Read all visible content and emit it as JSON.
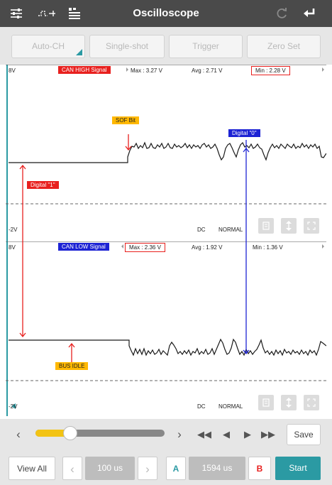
{
  "header": {
    "title": "Oscilloscope",
    "icons": [
      "settings-sliders-icon",
      "waveform-measure-icon",
      "channel-list-icon",
      "refresh-icon",
      "back-arrow-icon"
    ]
  },
  "channel_buttons": [
    "Auto-CH",
    "Single-shot",
    "Trigger",
    "Zero Set"
  ],
  "ch1": {
    "top_voltage": "8V",
    "bottom_voltage": "-2V",
    "signal_name": "CAN HIGH Signal",
    "max": "Max : 3.27 V",
    "avg": "Avg : 2.71 V",
    "min": "Min : 2.28 V",
    "coupling": "DC",
    "mode": "NORMAL",
    "annotations": {
      "sof": "SOF Bit",
      "digital_zero": "Digital \"0\"",
      "digital_one": "Digital \"1\""
    }
  },
  "ch2": {
    "top_voltage": "8V",
    "bottom_voltage": "-2V",
    "signal_name": "CAN LOW Signal",
    "max": "Max : 2.36 V",
    "avg": "Avg : 1.92 V",
    "min": "Min : 1.36 V",
    "coupling": "DC",
    "mode": "NORMAL",
    "annotations": {
      "bus_idle": "BUS IDLE"
    }
  },
  "controls": {
    "save_label": "Save",
    "slider_position": 0.27
  },
  "bottom": {
    "view_all": "View All",
    "time_div": "100 us",
    "cursor_a_label": "A",
    "cursor_delta": "1594 us",
    "cursor_b_label": "B",
    "start": "Start"
  },
  "colors": {
    "topbar": "#4a4a4a",
    "accent_teal": "#2b9aa3",
    "signal_red": "#e8201e",
    "signal_blue": "#1d23d4",
    "annotation_orange": "#ffb800",
    "slider_yellow": "#f2c314"
  }
}
